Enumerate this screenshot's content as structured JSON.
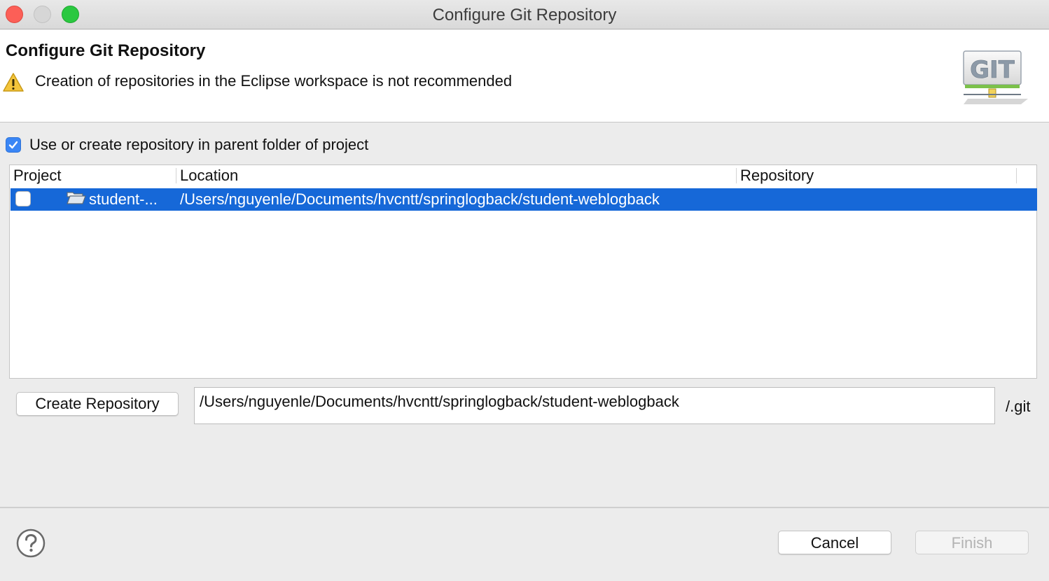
{
  "window": {
    "title": "Configure Git Repository"
  },
  "header": {
    "title": "Configure Git Repository",
    "warning": "Creation of repositories in the Eclipse workspace is not recommended",
    "logo_text": "GIT"
  },
  "options": {
    "use_parent_label": "Use or create repository in parent folder of project",
    "use_parent_checked": true
  },
  "table": {
    "columns": [
      "Project",
      "Location",
      "Repository"
    ],
    "rows": [
      {
        "checked": false,
        "project": "student-...",
        "location": "/Users/nguyenle/Documents/hvcntt/springlogback/student-weblogback",
        "repository": "",
        "selected": true
      }
    ]
  },
  "create": {
    "button_label": "Create Repository",
    "path_value": "/Users/nguyenle/Documents/hvcntt/springlogback/student-weblogback",
    "suffix": "/.git"
  },
  "footer": {
    "help_icon": "help-icon",
    "cancel_label": "Cancel",
    "finish_label": "Finish",
    "finish_enabled": false
  },
  "colors": {
    "selection": "#1668d8",
    "checkbox_checked": "#3a86f5",
    "close": "#fc5f57",
    "maximize": "#2ac840",
    "warning": "#f4c53b"
  }
}
